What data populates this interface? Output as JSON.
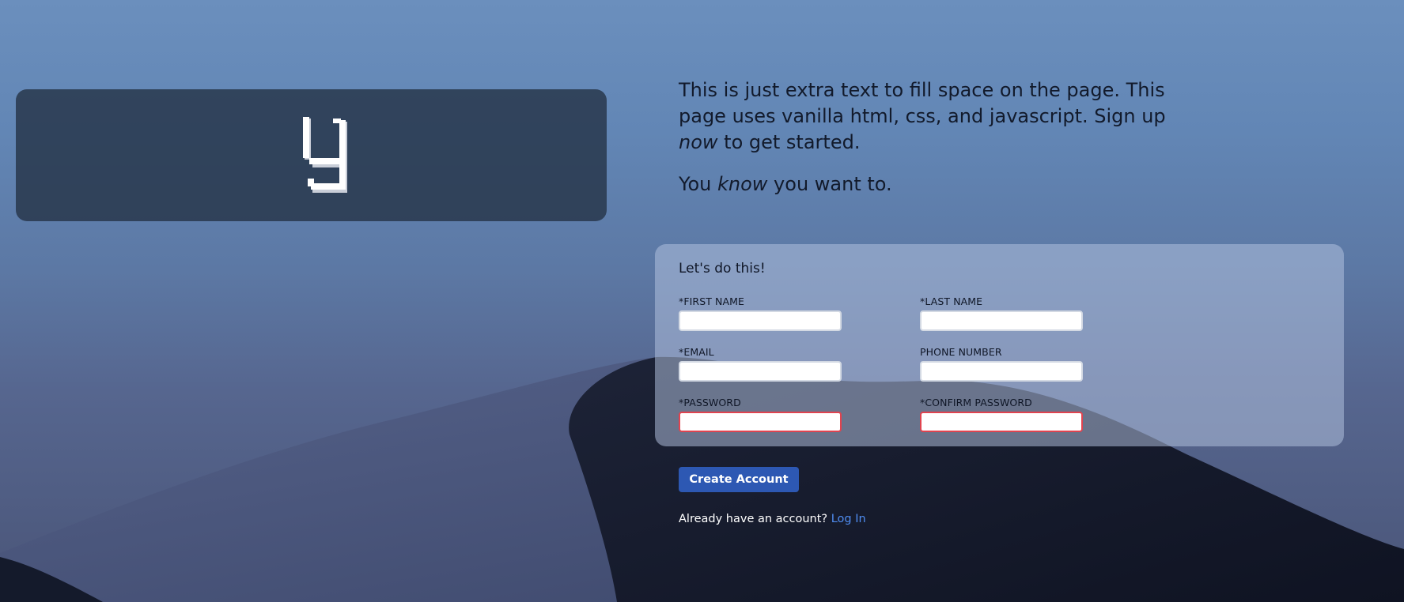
{
  "logo": {
    "icon": "y-pixel-logo-icon"
  },
  "intro": {
    "p1_a": "This is just extra text to fill space on the page. This page uses vanilla html, css, and javascript. Sign up ",
    "p1_em": "now",
    "p1_b": " to get started.",
    "p2_a": "You ",
    "p2_em": "know",
    "p2_b": " you want to."
  },
  "form": {
    "title": "Let's do this!",
    "fields": [
      {
        "label": "*FIRST NAME",
        "value": "",
        "invalid": false
      },
      {
        "label": "*LAST NAME",
        "value": "",
        "invalid": false
      },
      {
        "label": "*EMAIL",
        "value": "",
        "invalid": false
      },
      {
        "label": "PHONE NUMBER",
        "value": "",
        "invalid": false
      },
      {
        "label": "*PASSWORD",
        "value": "",
        "invalid": true
      },
      {
        "label": "*CONFIRM PASSWORD",
        "value": "",
        "invalid": true
      }
    ]
  },
  "actions": {
    "create_label": "Create Account",
    "login_prompt": "Already have an account?",
    "login_link": "Log In"
  },
  "colors": {
    "button": "#2d58b3",
    "link": "#4f8cf0",
    "invalid_border": "#e0434f",
    "text_dark": "#121a2b"
  }
}
